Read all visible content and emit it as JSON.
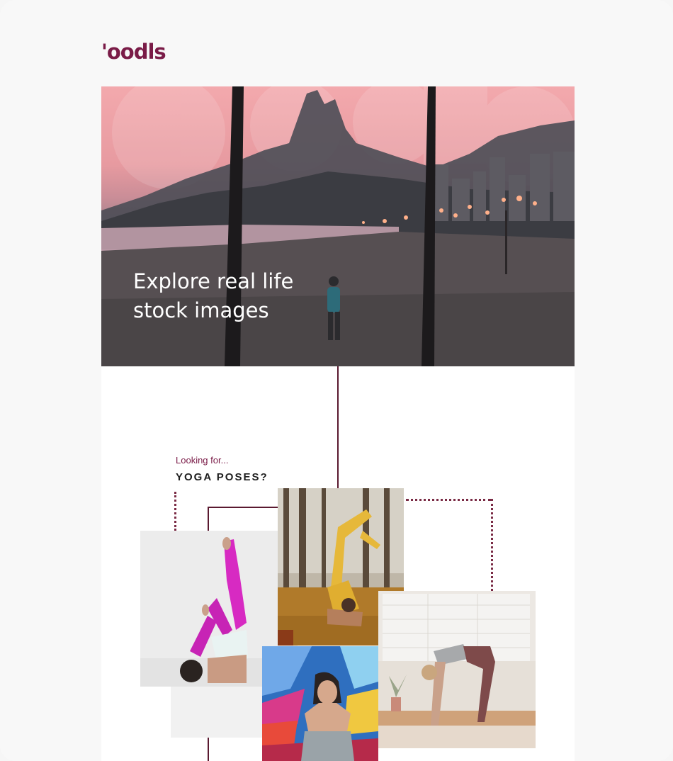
{
  "brand": {
    "logo_text": "ꞌoodls",
    "color": "#7a1b47"
  },
  "hero": {
    "title_line1": "Explore real life",
    "title_line2": "stock images",
    "image": "beach-mountain-sunset-photo"
  },
  "section": {
    "eyebrow": "Looking for...",
    "heading": "YOGA POSES?"
  },
  "photos": [
    {
      "name": "yoga-photo-headstand-pink-leggings"
    },
    {
      "name": "yoga-photo-forest-leaves"
    },
    {
      "name": "yoga-photo-window-stretch"
    },
    {
      "name": "yoga-photo-graffiti-wall"
    }
  ],
  "colors": {
    "accent": "#7a1b47",
    "connector": "#5a1a30",
    "background": "#f8f8f8"
  }
}
